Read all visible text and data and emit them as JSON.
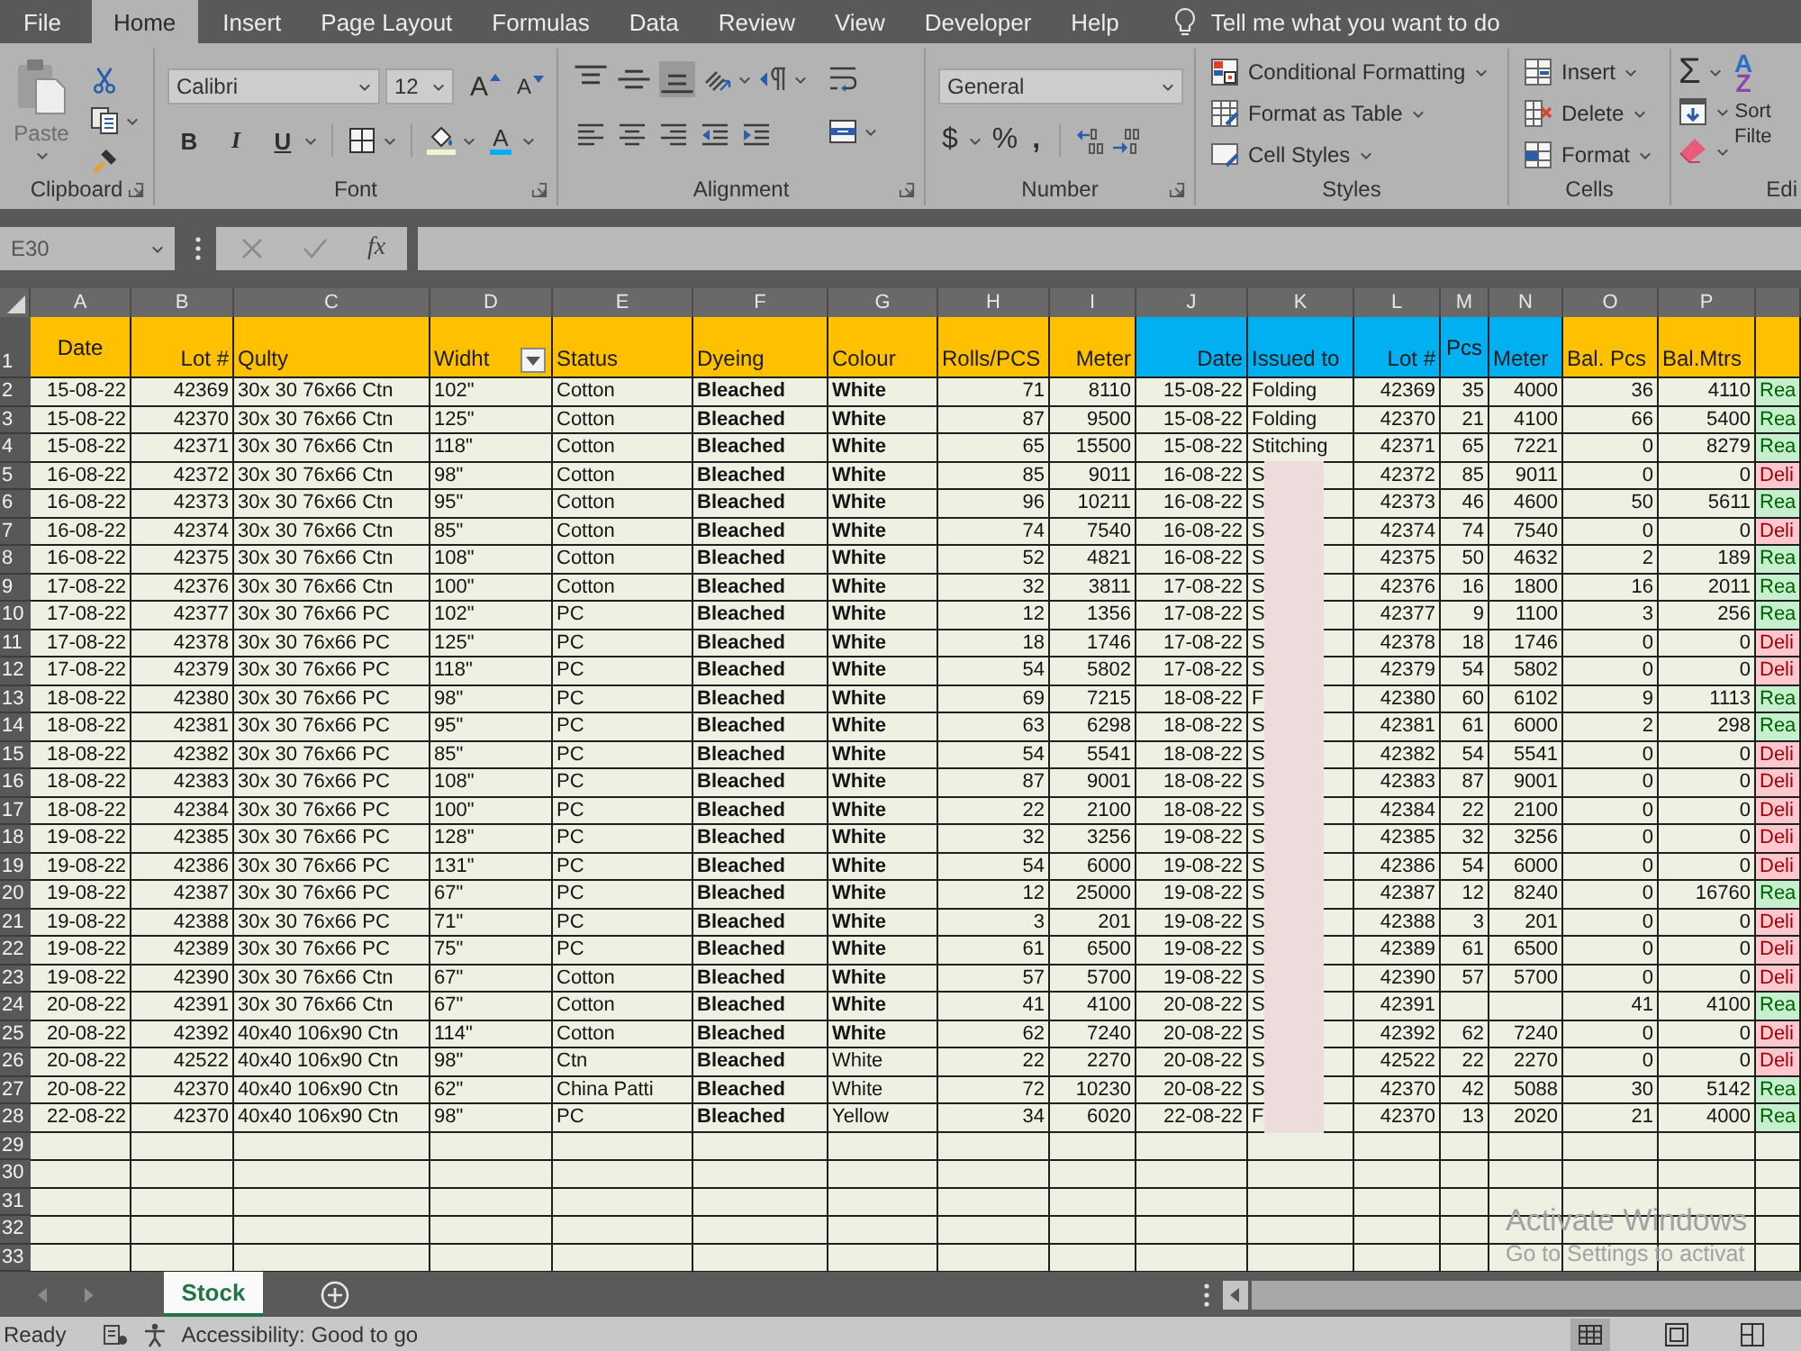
{
  "ribbon_tabs": [
    {
      "label": "File",
      "selected": false
    },
    {
      "label": "Home",
      "selected": true
    },
    {
      "label": "Insert",
      "selected": false
    },
    {
      "label": "Page Layout",
      "selected": false
    },
    {
      "label": "Formulas",
      "selected": false
    },
    {
      "label": "Data",
      "selected": false
    },
    {
      "label": "Review",
      "selected": false
    },
    {
      "label": "View",
      "selected": false
    },
    {
      "label": "Developer",
      "selected": false
    },
    {
      "label": "Help",
      "selected": false
    }
  ],
  "tell_me": {
    "placeholder": "Tell me what you want to do"
  },
  "clipboard": {
    "label": "Clipboard",
    "paste": "Paste"
  },
  "font": {
    "label": "Font",
    "font_name": "Calibri",
    "font_size": "12",
    "grow_font": "A",
    "shrink_font": "A",
    "bold": "B",
    "italic": "I",
    "underline": "U",
    "font_color": "A"
  },
  "alignment": {
    "label": "Alignment",
    "vertical_align": [
      {
        "selected": false
      },
      {
        "selected": false
      },
      {
        "selected": true
      }
    ]
  },
  "number": {
    "label": "Number",
    "format": "General",
    "currency": "$",
    "percent": "%",
    "comma": ","
  },
  "styles": {
    "label": "Styles",
    "items": [
      "Conditional Formatting",
      "Format as Table",
      "Cell Styles"
    ]
  },
  "cells": {
    "label": "Cells",
    "items": [
      "Insert",
      "Delete",
      "Format"
    ]
  },
  "editing": {
    "label": "Edi",
    "sum": "Σ",
    "sort_letters": [
      "A",
      "Z"
    ],
    "sort_filter": [
      "Sort",
      "Filte"
    ]
  },
  "formula_bar": {
    "name_box": "E30",
    "function_label": "fx"
  },
  "sheet": {
    "columns": [
      {
        "letter": "A",
        "title": "Date",
        "color": "#ffc000",
        "filter": false
      },
      {
        "letter": "B",
        "title": "Lot #",
        "color": "#ffc000",
        "filter": false
      },
      {
        "letter": "C",
        "title": "Qulty",
        "color": "#ffc000",
        "filter": false
      },
      {
        "letter": "D",
        "title": "Widht",
        "color": "#ffc000",
        "filter": true
      },
      {
        "letter": "E",
        "title": "Status",
        "color": "#ffc000",
        "filter": false
      },
      {
        "letter": "F",
        "title": "Dyeing",
        "color": "#ffc000",
        "filter": false
      },
      {
        "letter": "G",
        "title": "Colour",
        "color": "#ffc000",
        "filter": false
      },
      {
        "letter": "H",
        "title": "Rolls/PCS",
        "color": "#ffc000",
        "filter": false
      },
      {
        "letter": "I",
        "title": "Meter",
        "color": "#ffc000",
        "filter": false
      },
      {
        "letter": "J",
        "title": "Date",
        "color": "#00b0f0",
        "filter": false
      },
      {
        "letter": "K",
        "title": "Issued to",
        "color": "#00b0f0",
        "filter": false
      },
      {
        "letter": "L",
        "title": "Lot #",
        "color": "#00b0f0",
        "filter": false
      },
      {
        "letter": "M",
        "title": "Pcs",
        "color": "#00b0f0",
        "filter": false
      },
      {
        "letter": "N",
        "title": "Meter",
        "color": "#00b0f0",
        "filter": false
      },
      {
        "letter": "O",
        "title": "Bal. Pcs",
        "color": "#ffc000",
        "filter": false
      },
      {
        "letter": "P",
        "title": "Bal.Mtrs",
        "color": "#ffc000",
        "filter": false
      },
      {
        "color": "#ffc000",
        "filter": false
      }
    ],
    "header_row": "1",
    "rows": [
      {
        "number": "2",
        "cells": [
          "15-08-22",
          "42369",
          "30x 30 76x66 Ctn",
          "102\"",
          "Cotton",
          "Bleached",
          "White",
          "71",
          "8110",
          "15-08-22",
          "Folding",
          "42369",
          "35",
          "4000",
          "36",
          "4110"
        ],
        "redacted": false,
        "colour_bold": true,
        "column_q": {
          "text": "Rea",
          "kind": "good"
        }
      },
      {
        "number": "3",
        "cells": [
          "15-08-22",
          "42370",
          "30x 30 76x66 Ctn",
          "125\"",
          "Cotton",
          "Bleached",
          "White",
          "87",
          "9500",
          "15-08-22",
          "Folding",
          "42370",
          "21",
          "4100",
          "66",
          "5400"
        ],
        "redacted": false,
        "colour_bold": true,
        "column_q": {
          "text": "Rea",
          "kind": "good"
        }
      },
      {
        "number": "4",
        "cells": [
          "15-08-22",
          "42371",
          "30x 30 76x66 Ctn",
          "118\"",
          "Cotton",
          "Bleached",
          "White",
          "65",
          "15500",
          "15-08-22",
          "Stitching",
          "42371",
          "65",
          "7221",
          "0",
          "8279"
        ],
        "redacted": false,
        "colour_bold": true,
        "column_q": {
          "text": "Rea",
          "kind": "good"
        }
      },
      {
        "number": "5",
        "cells": [
          "16-08-22",
          "42372",
          "30x 30 76x66 Ctn",
          "98\"",
          "Cotton",
          "Bleached",
          "White",
          "85",
          "9011",
          "16-08-22",
          "S",
          "42372",
          "85",
          "9011",
          "0",
          "0"
        ],
        "redacted": true,
        "colour_bold": true,
        "column_q": {
          "text": "Deli",
          "kind": "bad"
        }
      },
      {
        "number": "6",
        "cells": [
          "16-08-22",
          "42373",
          "30x 30 76x66 Ctn",
          "95\"",
          "Cotton",
          "Bleached",
          "White",
          "96",
          "10211",
          "16-08-22",
          "S",
          "42373",
          "46",
          "4600",
          "50",
          "5611"
        ],
        "redacted": true,
        "colour_bold": true,
        "column_q": {
          "text": "Rea",
          "kind": "good"
        }
      },
      {
        "number": "7",
        "cells": [
          "16-08-22",
          "42374",
          "30x 30 76x66 Ctn",
          "85\"",
          "Cotton",
          "Bleached",
          "White",
          "74",
          "7540",
          "16-08-22",
          "S",
          "42374",
          "74",
          "7540",
          "0",
          "0"
        ],
        "redacted": true,
        "colour_bold": true,
        "column_q": {
          "text": "Deli",
          "kind": "bad"
        }
      },
      {
        "number": "8",
        "cells": [
          "16-08-22",
          "42375",
          "30x 30 76x66 Ctn",
          "108\"",
          "Cotton",
          "Bleached",
          "White",
          "52",
          "4821",
          "16-08-22",
          "S",
          "42375",
          "50",
          "4632",
          "2",
          "189"
        ],
        "redacted": true,
        "colour_bold": true,
        "column_q": {
          "text": "Rea",
          "kind": "good"
        }
      },
      {
        "number": "9",
        "cells": [
          "17-08-22",
          "42376",
          "30x 30 76x66 Ctn",
          "100\"",
          "Cotton",
          "Bleached",
          "White",
          "32",
          "3811",
          "17-08-22",
          "S",
          "42376",
          "16",
          "1800",
          "16",
          "2011"
        ],
        "redacted": true,
        "colour_bold": true,
        "column_q": {
          "text": "Rea",
          "kind": "good"
        }
      },
      {
        "number": "10",
        "cells": [
          "17-08-22",
          "42377",
          "30x 30 76x66 PC",
          "102\"",
          "PC",
          "Bleached",
          "White",
          "12",
          "1356",
          "17-08-22",
          "S",
          "42377",
          "9",
          "1100",
          "3",
          "256"
        ],
        "redacted": true,
        "colour_bold": true,
        "column_q": {
          "text": "Rea",
          "kind": "good"
        }
      },
      {
        "number": "11",
        "cells": [
          "17-08-22",
          "42378",
          "30x 30 76x66 PC",
          "125\"",
          "PC",
          "Bleached",
          "White",
          "18",
          "1746",
          "17-08-22",
          "S",
          "42378",
          "18",
          "1746",
          "0",
          "0"
        ],
        "redacted": true,
        "colour_bold": true,
        "column_q": {
          "text": "Deli",
          "kind": "bad"
        }
      },
      {
        "number": "12",
        "cells": [
          "17-08-22",
          "42379",
          "30x 30 76x66 PC",
          "118\"",
          "PC",
          "Bleached",
          "White",
          "54",
          "5802",
          "17-08-22",
          "S",
          "42379",
          "54",
          "5802",
          "0",
          "0"
        ],
        "redacted": true,
        "colour_bold": true,
        "column_q": {
          "text": "Deli",
          "kind": "bad"
        }
      },
      {
        "number": "13",
        "cells": [
          "18-08-22",
          "42380",
          "30x 30 76x66 PC",
          "98\"",
          "PC",
          "Bleached",
          "White",
          "69",
          "7215",
          "18-08-22",
          "F",
          "42380",
          "60",
          "6102",
          "9",
          "1113"
        ],
        "redacted": true,
        "colour_bold": true,
        "column_q": {
          "text": "Rea",
          "kind": "good"
        }
      },
      {
        "number": "14",
        "cells": [
          "18-08-22",
          "42381",
          "30x 30 76x66 PC",
          "95\"",
          "PC",
          "Bleached",
          "White",
          "63",
          "6298",
          "18-08-22",
          "S",
          "42381",
          "61",
          "6000",
          "2",
          "298"
        ],
        "redacted": true,
        "colour_bold": true,
        "column_q": {
          "text": "Rea",
          "kind": "good"
        }
      },
      {
        "number": "15",
        "cells": [
          "18-08-22",
          "42382",
          "30x 30 76x66 PC",
          "85\"",
          "PC",
          "Bleached",
          "White",
          "54",
          "5541",
          "18-08-22",
          "S",
          "42382",
          "54",
          "5541",
          "0",
          "0"
        ],
        "redacted": true,
        "colour_bold": true,
        "column_q": {
          "text": "Deli",
          "kind": "bad"
        }
      },
      {
        "number": "16",
        "cells": [
          "18-08-22",
          "42383",
          "30x 30 76x66 PC",
          "108\"",
          "PC",
          "Bleached",
          "White",
          "87",
          "9001",
          "18-08-22",
          "S",
          "42383",
          "87",
          "9001",
          "0",
          "0"
        ],
        "redacted": true,
        "colour_bold": true,
        "column_q": {
          "text": "Deli",
          "kind": "bad"
        }
      },
      {
        "number": "17",
        "cells": [
          "18-08-22",
          "42384",
          "30x 30 76x66 PC",
          "100\"",
          "PC",
          "Bleached",
          "White",
          "22",
          "2100",
          "18-08-22",
          "S",
          "42384",
          "22",
          "2100",
          "0",
          "0"
        ],
        "redacted": true,
        "colour_bold": true,
        "column_q": {
          "text": "Deli",
          "kind": "bad"
        }
      },
      {
        "number": "18",
        "cells": [
          "19-08-22",
          "42385",
          "30x 30 76x66 PC",
          "128\"",
          "PC",
          "Bleached",
          "White",
          "32",
          "3256",
          "19-08-22",
          "S",
          "42385",
          "32",
          "3256",
          "0",
          "0"
        ],
        "redacted": true,
        "colour_bold": true,
        "column_q": {
          "text": "Deli",
          "kind": "bad"
        }
      },
      {
        "number": "19",
        "cells": [
          "19-08-22",
          "42386",
          "30x 30 76x66 PC",
          "131\"",
          "PC",
          "Bleached",
          "White",
          "54",
          "6000",
          "19-08-22",
          "S",
          "42386",
          "54",
          "6000",
          "0",
          "0"
        ],
        "redacted": true,
        "colour_bold": true,
        "column_q": {
          "text": "Deli",
          "kind": "bad"
        }
      },
      {
        "number": "20",
        "cells": [
          "19-08-22",
          "42387",
          "30x 30 76x66 PC",
          "67\"",
          "PC",
          "Bleached",
          "White",
          "12",
          "25000",
          "19-08-22",
          "S",
          "42387",
          "12",
          "8240",
          "0",
          "16760"
        ],
        "redacted": true,
        "colour_bold": true,
        "column_q": {
          "text": "Rea",
          "kind": "good"
        }
      },
      {
        "number": "21",
        "cells": [
          "19-08-22",
          "42388",
          "30x 30 76x66 PC",
          "71\"",
          "PC",
          "Bleached",
          "White",
          "3",
          "201",
          "19-08-22",
          "S",
          "42388",
          "3",
          "201",
          "0",
          "0"
        ],
        "redacted": true,
        "colour_bold": true,
        "column_q": {
          "text": "Deli",
          "kind": "bad"
        }
      },
      {
        "number": "22",
        "cells": [
          "19-08-22",
          "42389",
          "30x 30 76x66 PC",
          "75\"",
          "PC",
          "Bleached",
          "White",
          "61",
          "6500",
          "19-08-22",
          "S",
          "42389",
          "61",
          "6500",
          "0",
          "0"
        ],
        "redacted": true,
        "colour_bold": true,
        "column_q": {
          "text": "Deli",
          "kind": "bad"
        }
      },
      {
        "number": "23",
        "cells": [
          "19-08-22",
          "42390",
          "30x 30 76x66 Ctn",
          "67\"",
          "Cotton",
          "Bleached",
          "White",
          "57",
          "5700",
          "19-08-22",
          "S",
          "42390",
          "57",
          "5700",
          "0",
          "0"
        ],
        "redacted": true,
        "colour_bold": true,
        "column_q": {
          "text": "Deli",
          "kind": "bad"
        }
      },
      {
        "number": "24",
        "cells": [
          "20-08-22",
          "42391",
          "30x 30 76x66 Ctn",
          "67\"",
          "Cotton",
          "Bleached",
          "White",
          "41",
          "4100",
          "20-08-22",
          "S",
          "42391",
          null,
          null,
          "41",
          "4100"
        ],
        "redacted": true,
        "colour_bold": true,
        "column_q": {
          "text": "Rea",
          "kind": "good"
        }
      },
      {
        "number": "25",
        "cells": [
          "20-08-22",
          "42392",
          "40x40 106x90 Ctn",
          "114\"",
          "Cotton",
          "Bleached",
          "White",
          "62",
          "7240",
          "20-08-22",
          "S",
          "42392",
          "62",
          "7240",
          "0",
          "0"
        ],
        "redacted": true,
        "colour_bold": true,
        "column_q": {
          "text": "Deli",
          "kind": "bad"
        }
      },
      {
        "number": "26",
        "cells": [
          "20-08-22",
          "42522",
          "40x40 106x90 Ctn",
          "98\"",
          "Ctn",
          "Bleached",
          "White",
          "22",
          "2270",
          "20-08-22",
          "S",
          "42522",
          "22",
          "2270",
          "0",
          "0"
        ],
        "redacted": true,
        "colour_bold": false,
        "column_q": {
          "text": "Deli",
          "kind": "bad"
        }
      },
      {
        "number": "27",
        "cells": [
          "20-08-22",
          "42370",
          "40x40 106x90 Ctn",
          "62\"",
          "China Patti",
          "Bleached",
          "White",
          "72",
          "10230",
          "20-08-22",
          "S",
          "42370",
          "42",
          "5088",
          "30",
          "5142"
        ],
        "redacted": true,
        "colour_bold": false,
        "column_q": {
          "text": "Rea",
          "kind": "good"
        }
      },
      {
        "number": "28",
        "cells": [
          "22-08-22",
          "42370",
          "40x40 106x90 Ctn",
          "98\"",
          "PC",
          "Bleached",
          "Yellow",
          "34",
          "6020",
          "22-08-22",
          "F",
          "42370",
          "13",
          "2020",
          "21",
          "4000"
        ],
        "redacted": true,
        "colour_bold": false,
        "column_q": {
          "text": "Rea",
          "kind": "good"
        }
      }
    ],
    "empty_rows": [
      "29",
      "30",
      "31",
      "32",
      "33"
    ]
  },
  "activation_notice": {
    "title": "Activate Windows",
    "subtitle": "Go to Settings to activat"
  },
  "sheet_tabs": [
    {
      "label": "Stock",
      "selected": true
    }
  ],
  "status_bar": {
    "mode": "Ready",
    "accessibility": "Accessibility: Good to go"
  }
}
